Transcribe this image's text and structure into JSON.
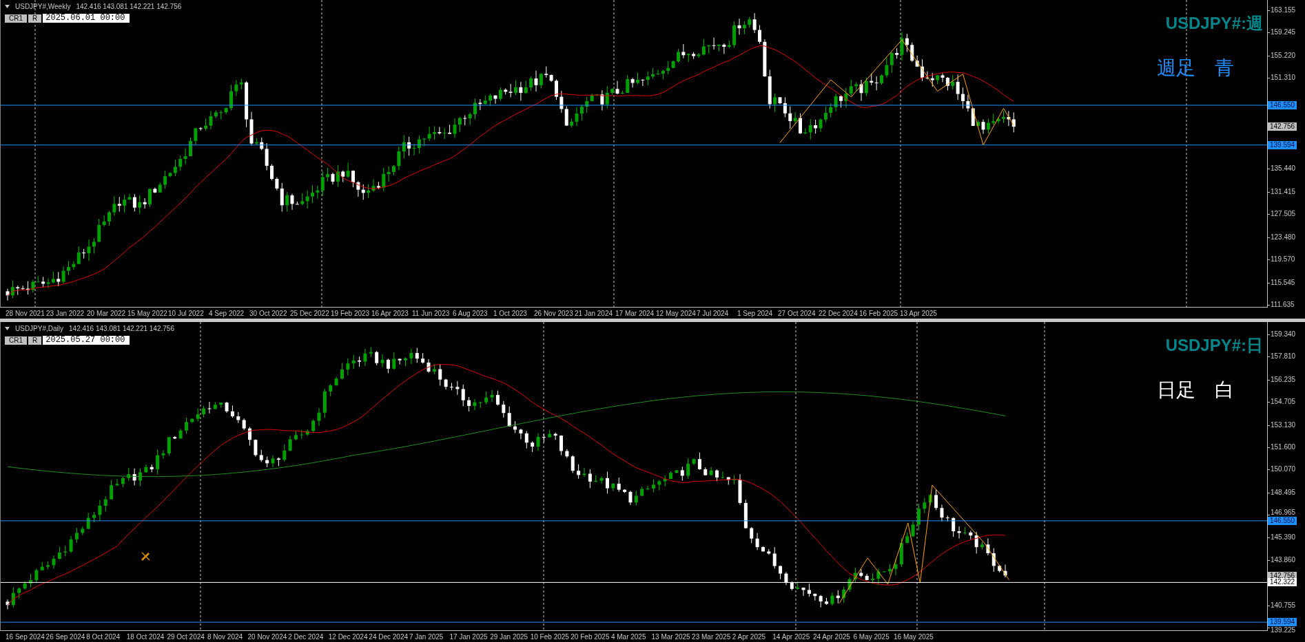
{
  "panes": [
    {
      "kind": "weekly",
      "symbol": "USDJPY#,Weekly",
      "ohlc": "142.416 143.081 142.221 142.756",
      "buttons": [
        "CR1",
        "R"
      ],
      "datetime": "2025.06.01 00:00",
      "chart_label": "USDJPY#:週",
      "note": "週足　青",
      "color": "#1e90ff",
      "price_ticks": [
        "163.155",
        "159.245",
        "155.220",
        "151.310",
        "135.440",
        "131.415",
        "127.505",
        "123.480",
        "119.570",
        "115.545",
        "111.635"
      ],
      "price_tags": [
        {
          "label": "146.550",
          "kind": "level"
        },
        {
          "label": "142.756",
          "kind": "bid"
        },
        {
          "label": "139.594",
          "kind": "level"
        }
      ],
      "dates": [
        "28 Nov 2021",
        "23 Jan 2022",
        "20 Mar 2022",
        "15 May 2022",
        "10 Jul 2022",
        "4 Sep 2022",
        "30 Oct 2022",
        "25 Dec 2022",
        "19 Feb 2023",
        "16 Apr 2023",
        "11 Jun 2023",
        "6 Aug 2023",
        "1 Oct 2023",
        "26 Nov 2023",
        "21 Jan 2024",
        "17 Mar 2024",
        "12 May 2024",
        "7 Jul 2024",
        "1 Sep 2024",
        "27 Oct 2024",
        "22 Dec 2024",
        "16 Feb 2025",
        "13 Apr 2025"
      ]
    },
    {
      "kind": "daily",
      "symbol": "USDJPY#,Daily",
      "ohlc": "142.416 143.081 142.221 142.756",
      "buttons": [
        "CR1",
        "R"
      ],
      "datetime": "2025.05.27 00:00",
      "chart_label": "USDJPY#:日",
      "note": "日足　白",
      "color": "#ffffff",
      "price_ticks": [
        "159.340",
        "157.810",
        "156.235",
        "154.705",
        "153.130",
        "151.600",
        "150.070",
        "148.495",
        "146.965",
        "145.390",
        "143.860",
        "140.755",
        "139.225"
      ],
      "price_tags": [
        {
          "label": "146.550",
          "kind": "level"
        },
        {
          "label": "142.756",
          "kind": "bid"
        },
        {
          "label": "142.322",
          "kind": "line"
        },
        {
          "label": "139.594",
          "kind": "level"
        }
      ],
      "dates": [
        "16 Sep 2024",
        "26 Sep 2024",
        "8 Oct 2024",
        "18 Oct 2024",
        "29 Oct 2024",
        "8 Nov 2024",
        "20 Nov 2024",
        "2 Dec 2024",
        "12 Dec 2024",
        "24 Dec 2024",
        "7 Jan 2025",
        "17 Jan 2025",
        "29 Jan 2025",
        "10 Feb 2025",
        "20 Feb 2025",
        "4 Mar 2025",
        "13 Mar 2025",
        "23 Mar 2025",
        "2 Apr 2025",
        "14 Apr 2025",
        "24 Apr 2025",
        "6 May 2025",
        "16 May 2025"
      ]
    }
  ]
}
